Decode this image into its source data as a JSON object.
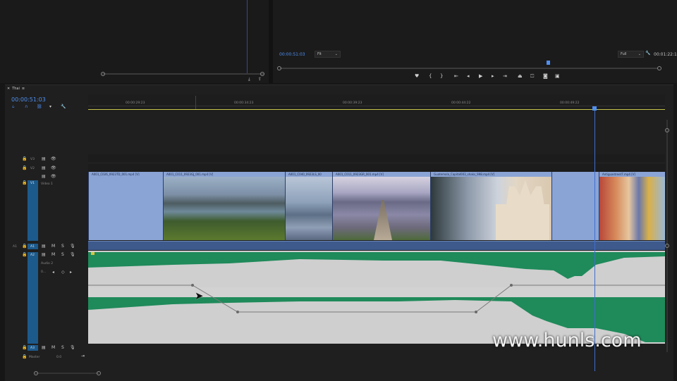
{
  "source_monitor": {
    "label": ""
  },
  "program_monitor": {
    "timecode_left": "00:00:51:03",
    "fit_label": "Fit",
    "quality_label": "Full",
    "timecode_right": "00:01:22:1"
  },
  "sequence": {
    "tab_label": "Thai",
    "timecode": "00:00:51:03"
  },
  "ruler": {
    "ticks": [
      "00:00:29:23",
      "00:00:34:23",
      "00:00:39:23",
      "00:00:44:22",
      "00:00:49:22"
    ]
  },
  "tracks": {
    "v3": "V3",
    "v2": "V2",
    "v1": "V1",
    "video1_name": "Video 1",
    "a1_src": "A1",
    "a1": "A1",
    "a2": "A2",
    "audio2_name": "Audio 2",
    "a3": "A3",
    "master_label": "Master",
    "master_value": "0.0",
    "audio2_level": "0..."
  },
  "clips": [
    {
      "name": "A001_C026_0923TD_001.mp4 [V]"
    },
    {
      "name": "A001_C011_0923GJ_001.mp4 [V]"
    },
    {
      "name": "A001_C040_0923LS_00"
    },
    {
      "name": "A001_C011_0923GR_001.mp4 [V]"
    },
    {
      "name": "Guatemala_Capital003_shaks_998.mp4 [V]"
    },
    {
      "name": "Antiguastreet7.mp4 [V]"
    }
  ],
  "watermark": "www.hunls.com",
  "colors": {
    "accent": "#4f8ff0",
    "audio_wave": "#1f8a5a",
    "video_clip": "#8aa4d6",
    "track_selected": "#1c5a8c"
  }
}
